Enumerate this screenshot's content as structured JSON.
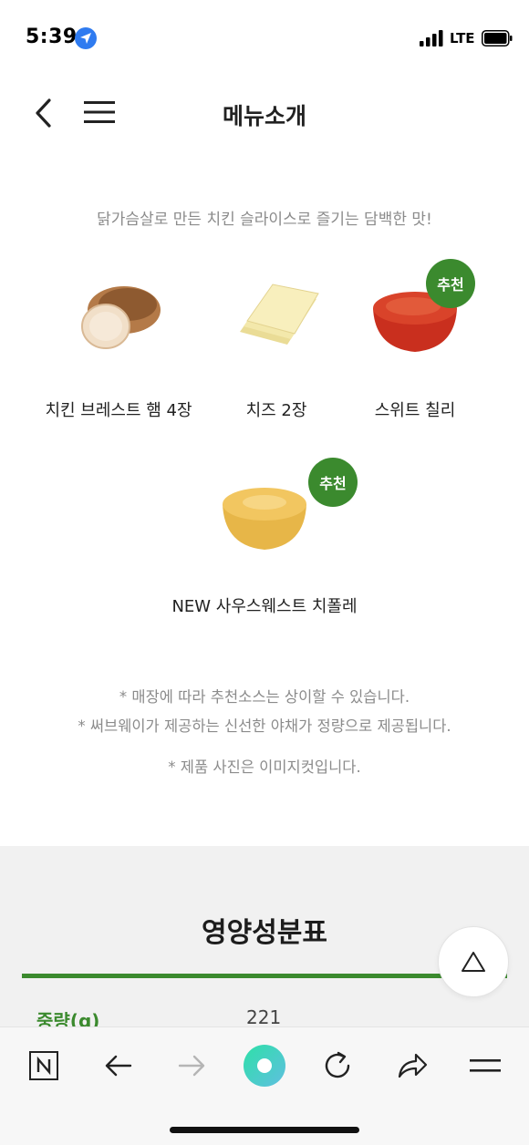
{
  "status_bar": {
    "time": "5:39",
    "network": "LTE"
  },
  "header": {
    "title": "메뉴소개"
  },
  "intro": "닭가슴살로 만든 치킨 슬라이스로 즐기는 담백한 맛!",
  "ingredients": [
    {
      "label": "치킨 브레스트 햄 4장",
      "icon": "chicken-ham-icon"
    },
    {
      "label": "치즈 2장",
      "icon": "cheese-icon"
    },
    {
      "label": "스위트 칠리",
      "icon": "sweet-chili-sauce-icon",
      "badge": "추천"
    },
    {
      "label": "NEW 사우스웨스트 치폴레",
      "icon": "chipotle-sauce-icon",
      "badge": "추천"
    }
  ],
  "notes": [
    "* 매장에 따라 추천소스는 상이할 수 있습니다.",
    "* 써브웨이가 제공하는 신선한 야채가 정량으로 제공됩니다.",
    "* 제품 사진은 이미지컷입니다."
  ],
  "nutrition": {
    "title": "영양성분표",
    "rows": [
      {
        "label": "중량(g)",
        "value": "221"
      }
    ]
  },
  "colors": {
    "brand_green": "#3b8a2e",
    "accent_teal": "#3fd0a0",
    "text_gray": "#8b8b8b"
  }
}
